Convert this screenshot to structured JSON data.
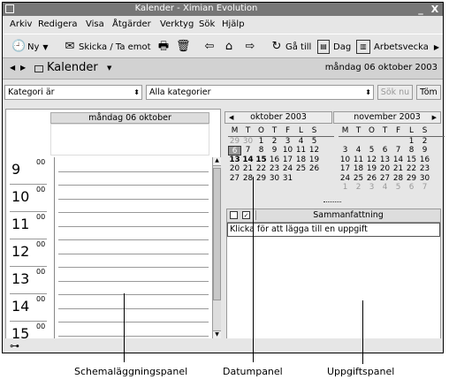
{
  "window": {
    "title": "Kalender - Ximian Evolution",
    "minimize": "_",
    "close": "X"
  },
  "menu": [
    "Arkiv",
    "Redigera",
    "Visa",
    "Åtgärder",
    "Verktyg",
    "Sök",
    "Hjälp"
  ],
  "toolbar": {
    "new_label": "Ny",
    "send_receive_label": "Skicka / Ta emot",
    "goto_label": "Gå till",
    "day_label": "Dag",
    "workweek_label": "Arbetsvecka"
  },
  "viewbar": {
    "title": "Kalender",
    "date": "måndag 06 oktober 2003"
  },
  "filter": {
    "category_label": "Kategori är",
    "category_value": "Alla kategorier",
    "search_button": "Sök nu",
    "clear_button": "Töm"
  },
  "dayview": {
    "header": "måndag 06 oktober",
    "hours": [
      {
        "h": "9",
        "m": "00"
      },
      {
        "h": "10",
        "m": "00"
      },
      {
        "h": "11",
        "m": "00"
      },
      {
        "h": "12",
        "m": "00"
      },
      {
        "h": "13",
        "m": "00"
      },
      {
        "h": "14",
        "m": "00"
      },
      {
        "h": "15",
        "m": "00"
      }
    ]
  },
  "calendar": {
    "weekdays": [
      "M",
      "T",
      "O",
      "T",
      "F",
      "L",
      "S"
    ],
    "month1": {
      "title": "oktober 2003",
      "rows": [
        [
          "29",
          "30",
          "1",
          "2",
          "3",
          "4",
          "5"
        ],
        [
          "6",
          "7",
          "8",
          "9",
          "10",
          "11",
          "12"
        ],
        [
          "13",
          "14",
          "15",
          "16",
          "17",
          "18",
          "19"
        ],
        [
          "20",
          "21",
          "22",
          "23",
          "24",
          "25",
          "26"
        ],
        [
          "27",
          "28",
          "29",
          "30",
          "31",
          "",
          ""
        ]
      ]
    },
    "month2": {
      "title": "november 2003",
      "rows": [
        [
          "",
          "",
          "",
          "",
          "",
          "1",
          "2"
        ],
        [
          "3",
          "4",
          "5",
          "6",
          "7",
          "8",
          "9"
        ],
        [
          "10",
          "11",
          "12",
          "13",
          "14",
          "15",
          "16"
        ],
        [
          "17",
          "18",
          "19",
          "20",
          "21",
          "22",
          "23"
        ],
        [
          "24",
          "25",
          "26",
          "27",
          "28",
          "29",
          "30"
        ],
        [
          "1",
          "2",
          "3",
          "4",
          "5",
          "6",
          "7"
        ]
      ]
    }
  },
  "tasks": {
    "column_summary": "Sammanfattning",
    "new_task_placeholder": "Klicka för att lägga till en uppgift"
  },
  "callouts": {
    "schedule": "Schemaläggningspanel",
    "date": "Datumpanel",
    "tasks": "Uppgiftspanel"
  }
}
